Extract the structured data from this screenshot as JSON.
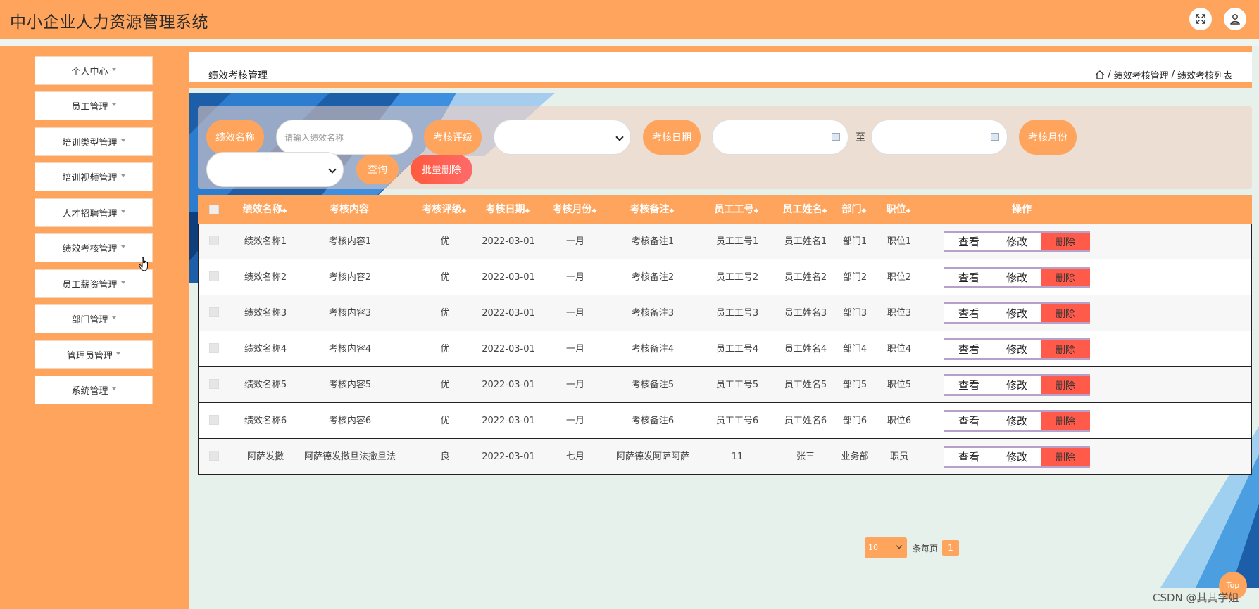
{
  "app": {
    "title": "中小企业人力资源管理系统"
  },
  "header": {
    "fullscreen_icon": "expand-icon",
    "user_icon": "user-icon"
  },
  "sidebar": {
    "items": [
      {
        "label": "个人中心"
      },
      {
        "label": "员工管理"
      },
      {
        "label": "培训类型管理"
      },
      {
        "label": "培训视频管理"
      },
      {
        "label": "人才招聘管理"
      },
      {
        "label": "绩效考核管理"
      },
      {
        "label": "员工薪资管理"
      },
      {
        "label": "部门管理"
      },
      {
        "label": "管理员管理"
      },
      {
        "label": "系统管理"
      }
    ]
  },
  "page": {
    "title": "绩效考核管理",
    "breadcrumb": [
      "绩效考核管理",
      "绩效考核列表"
    ],
    "breadcrumb_sep": "/"
  },
  "search": {
    "name_label": "绩效名称",
    "name_placeholder": "请输入绩效名称",
    "grade_label": "考核评级",
    "date_label": "考核日期",
    "to_label": "至",
    "month_label": "考核月份",
    "query_button": "查询",
    "batch_delete_button": "批量删除"
  },
  "table": {
    "headers": [
      "绩效名称",
      "考核内容",
      "考核评级",
      "考核日期",
      "考核月份",
      "考核备注",
      "员工工号",
      "员工姓名",
      "部门",
      "职位",
      "操作"
    ],
    "sort_glyph": "◆",
    "actions": {
      "view": "查看",
      "edit": "修改",
      "delete": "删除"
    },
    "rows": [
      [
        "绩效名称1",
        "考核内容1",
        "优",
        "2022-03-01",
        "一月",
        "考核备注1",
        "员工工号1",
        "员工姓名1",
        "部门1",
        "职位1"
      ],
      [
        "绩效名称2",
        "考核内容2",
        "优",
        "2022-03-01",
        "一月",
        "考核备注2",
        "员工工号2",
        "员工姓名2",
        "部门2",
        "职位2"
      ],
      [
        "绩效名称3",
        "考核内容3",
        "优",
        "2022-03-01",
        "一月",
        "考核备注3",
        "员工工号3",
        "员工姓名3",
        "部门3",
        "职位3"
      ],
      [
        "绩效名称4",
        "考核内容4",
        "优",
        "2022-03-01",
        "一月",
        "考核备注4",
        "员工工号4",
        "员工姓名4",
        "部门4",
        "职位4"
      ],
      [
        "绩效名称5",
        "考核内容5",
        "优",
        "2022-03-01",
        "一月",
        "考核备注5",
        "员工工号5",
        "员工姓名5",
        "部门5",
        "职位5"
      ],
      [
        "绩效名称6",
        "考核内容6",
        "优",
        "2022-03-01",
        "一月",
        "考核备注6",
        "员工工号6",
        "员工姓名6",
        "部门6",
        "职位6"
      ],
      [
        "阿萨发撒",
        "阿萨德发撒旦法撒旦法",
        "良",
        "2022-03-01",
        "七月",
        "阿萨德发阿萨阿萨",
        "11",
        "张三",
        "业务部",
        "职员"
      ]
    ]
  },
  "pagination": {
    "page_size": "10",
    "per_page_label": "条每页",
    "current_page": "1"
  },
  "scroll_top": {
    "label": "Top"
  },
  "watermark": {
    "text": "CSDN @其其学姐"
  },
  "colors": {
    "primary": "#ffa45c",
    "danger": "#ff5a4a",
    "page_bg": "#e6f1ec"
  }
}
